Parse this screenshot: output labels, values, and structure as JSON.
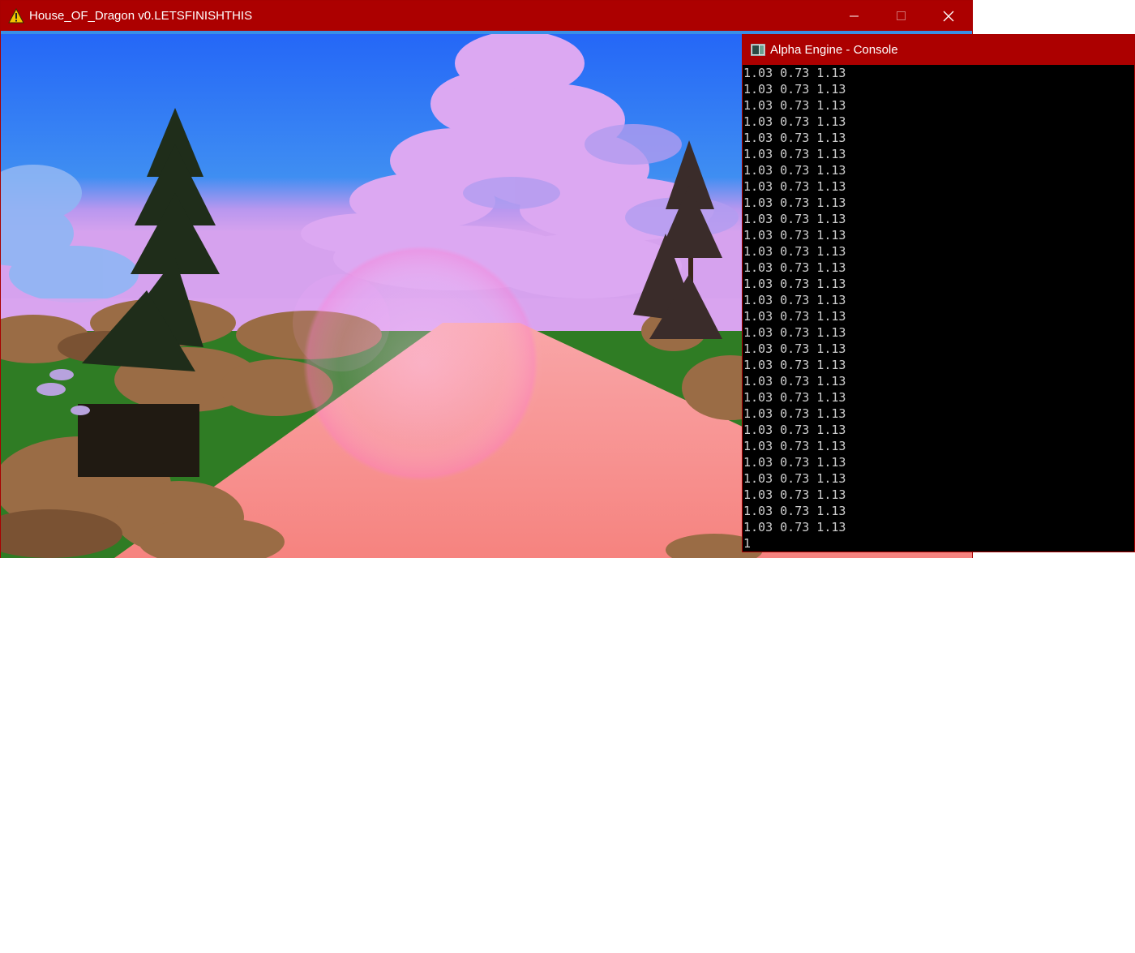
{
  "game_window": {
    "title": "House_OF_Dragon v0.LETSFINISHTHIS",
    "title_icon": "warning-icon",
    "controls": {
      "minimize": "minimize-icon",
      "maximize": "maximize-icon",
      "close": "close-icon"
    },
    "scene": {
      "description_icon": "game-viewport",
      "colors": {
        "sky_top": "#2a6ff5",
        "sky_horizon": "#d79ef0",
        "cloud": "#dca8f2",
        "grass": "#2e7a24",
        "road": "#f78c88",
        "bush": "#a0704a",
        "tree": "#1f2d1a"
      }
    }
  },
  "console_window": {
    "title": "Alpha Engine - Console",
    "title_icon": "console-app-icon",
    "lines": [
      "1.03 0.73 1.13",
      "1.03 0.73 1.13",
      "1.03 0.73 1.13",
      "1.03 0.73 1.13",
      "1.03 0.73 1.13",
      "1.03 0.73 1.13",
      "1.03 0.73 1.13",
      "1.03 0.73 1.13",
      "1.03 0.73 1.13",
      "1.03 0.73 1.13",
      "1.03 0.73 1.13",
      "1.03 0.73 1.13",
      "1.03 0.73 1.13",
      "1.03 0.73 1.13",
      "1.03 0.73 1.13",
      "1.03 0.73 1.13",
      "1.03 0.73 1.13",
      "1.03 0.73 1.13",
      "1.03 0.73 1.13",
      "1.03 0.73 1.13",
      "1.03 0.73 1.13",
      "1.03 0.73 1.13",
      "1.03 0.73 1.13",
      "1.03 0.73 1.13",
      "1.03 0.73 1.13",
      "1.03 0.73 1.13",
      "1.03 0.73 1.13",
      "1.03 0.73 1.13",
      "1.03 0.73 1.13",
      "1"
    ]
  }
}
